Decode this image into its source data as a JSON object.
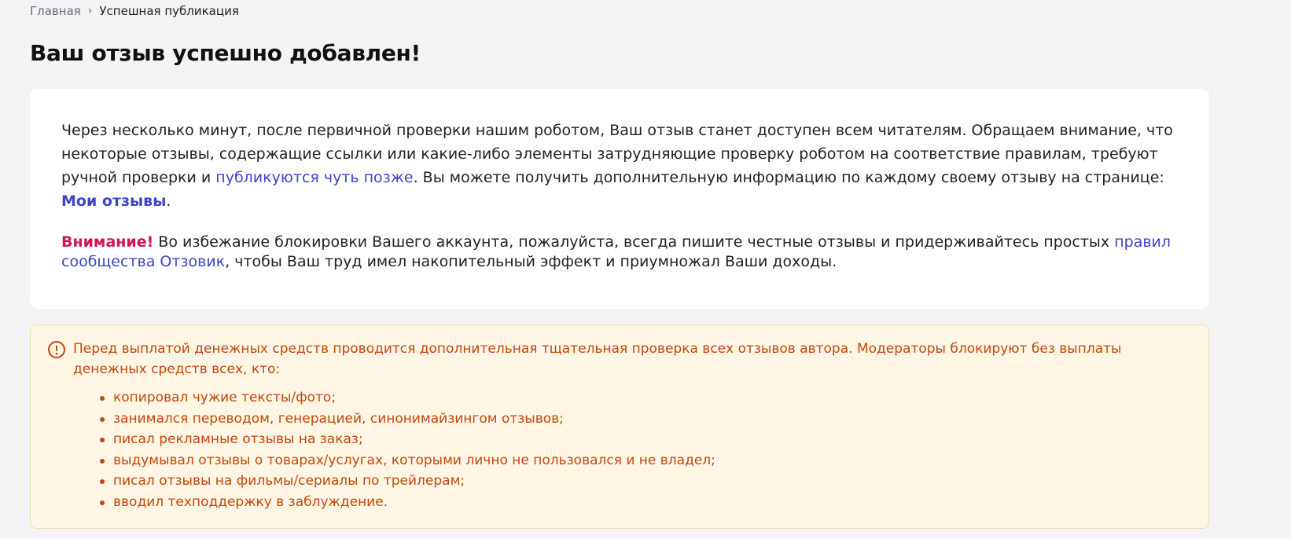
{
  "breadcrumb": {
    "home": "Главная",
    "separator": "›",
    "current": "Успешная публикация"
  },
  "title": "Ваш отзыв успешно добавлен!",
  "info": {
    "text_1": "Через несколько минут, после первичной проверки нашим роботом, Ваш отзыв станет доступен всем читателям. Обращаем внимание, что некоторые отзывы, содержащие ссылки или какие-либо элементы затрудняющие проверку роботом на соответствие правилам, требуют ручной проверки и ",
    "link_later": "публикуются чуть позже",
    "text_2": ". Вы можете получить дополнительную информацию по каждому своему отзыву на странице: ",
    "link_my_reviews": "Мои отзывы",
    "text_3": "."
  },
  "notice": {
    "attention": "Внимание!",
    "text_1": " Во избежание блокировки Вашего аккаунта, пожалуйста, всегда пишите честные отзывы и придерживайтесь простых ",
    "link_rules": "правил сообщества Отзовик",
    "text_2": ", чтобы Ваш труд имел накопительный эффект и приумножал Ваши доходы."
  },
  "warning": {
    "icon": "exclamation-circle-icon",
    "text": "Перед выплатой денежных средств проводится дополнительная тщательная проверка всех отзывов автора. Модераторы блокируют без выплаты денежных средств всех, кто:",
    "items": [
      "копировал чужие тексты/фото;",
      "занимался переводом, генерацией, синонимайзингом отзывов;",
      "писал рекламные отзывы на заказ;",
      "выдумывал отзывы о товарах/услугах, которыми лично не пользовался и не владел;",
      "писал отзывы на фильмы/сериалы по трейлерам;",
      "вводил техподдержку в заблуждение."
    ]
  },
  "colors": {
    "background": "#f4f4f6",
    "link": "#3b45c7",
    "attention": "#d1164f",
    "warning_text": "#c4470b",
    "warning_bg": "#fff6e5"
  }
}
